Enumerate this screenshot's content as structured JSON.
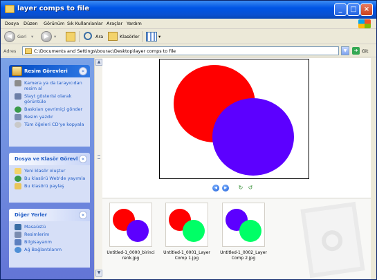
{
  "window": {
    "title": "layer comps to file"
  },
  "menu": [
    "Dosya",
    "Düzen",
    "Görünüm",
    "Sık Kullanılanlar",
    "Araçlar",
    "Yardım"
  ],
  "toolbar": {
    "back_label": "Geri",
    "search_label": "Ara",
    "folders_label": "Klasörler"
  },
  "address": {
    "label": "Adres",
    "path": "C:\\Documents and Settings\\bourac\\Desktop\\layer comps to file",
    "go_label": "Git"
  },
  "panels": [
    {
      "title": "Resim Görevleri",
      "items": [
        "Kamera ya da tarayıcıdan resim al",
        "Slayt gösterisi olarak görüntüle",
        "Baskıları çevrimiçi gönder",
        "Resim yazdır",
        "Tüm öğeleri CD'ye kopyala"
      ]
    },
    {
      "title": "Dosya ve Klasör Görevl",
      "items": [
        "Yeni klasör oluştur",
        "Bu klasörü Web'de yayımla",
        "Bu klasörü paylaş"
      ]
    },
    {
      "title": "Diğer Yerler",
      "items": [
        "Masaüstü",
        "Resimlerim",
        "Bilgisayarım",
        "Ağ Bağlantılarım"
      ]
    }
  ],
  "thumbnails": [
    {
      "label": "Untitled-1_0000_birinci renk.jpg"
    },
    {
      "label": "Untitled-1_0001_Layer Comp 1.jpg"
    },
    {
      "label": "Untitled-1_0002_Layer Comp 2.jpg"
    }
  ],
  "colors": {
    "red": "#FF0000",
    "blue": "#5C00FF",
    "green": "#00FF66",
    "link": "#215DC6"
  }
}
